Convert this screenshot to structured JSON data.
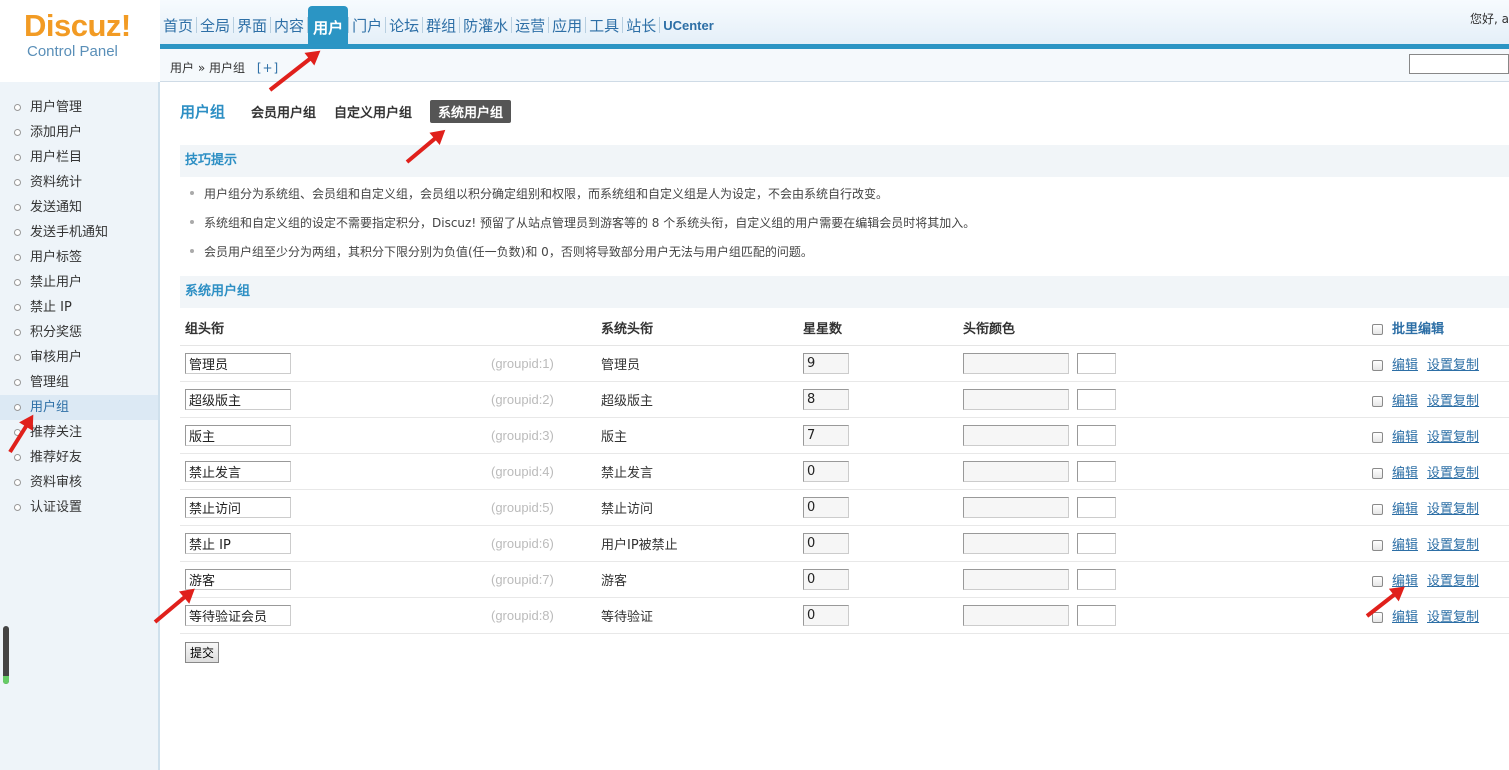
{
  "logo": {
    "main": "Discuz!",
    "sub": "Control Panel"
  },
  "nav": {
    "items": [
      "首页",
      "全局",
      "界面",
      "内容",
      "用户",
      "门户",
      "论坛",
      "群组",
      "防灌水",
      "运营",
      "应用",
      "工具",
      "站长",
      "UCenter"
    ],
    "active": "用户"
  },
  "greeting": "您好, a",
  "breadcrumb": {
    "path": "用户 » 用户组",
    "plus": "[+]"
  },
  "sidebar": {
    "items": [
      "用户管理",
      "添加用户",
      "用户栏目",
      "资料统计",
      "发送通知",
      "发送手机通知",
      "用户标签",
      "禁止用户",
      "禁止 IP",
      "积分奖惩",
      "审核用户",
      "管理组",
      "用户组",
      "推荐关注",
      "推荐好友",
      "资料审核",
      "认证设置"
    ],
    "active": "用户组"
  },
  "subnav": {
    "title": "用户组",
    "tabs": [
      "会员用户组",
      "自定义用户组",
      "系统用户组"
    ],
    "active": "系统用户组"
  },
  "tips": {
    "title": "技巧提示",
    "items": [
      "用户组分为系统组、会员组和自定义组，会员组以积分确定组别和权限，而系统组和自定义组是人为设定，不会由系统自行改变。",
      "系统组和自定义组的设定不需要指定积分，Discuz! 预留了从站点管理员到游客等的 8 个系统头衔，自定义组的用户需要在编辑会员时将其加入。",
      "会员用户组至少分为两组，其积分下限分别为负值(任一负数)和 0，否则将导致部分用户无法与用户组匹配的问题。"
    ]
  },
  "groups": {
    "title": "系统用户组",
    "headers": {
      "name": "组头衔",
      "system": "系统头衔",
      "stars": "星星数",
      "color": "头衔颜色",
      "batch": "批里编辑"
    },
    "rows": [
      {
        "name": "管理员",
        "gid": "(groupid:1)",
        "system": "管理员",
        "stars": "9"
      },
      {
        "name": "超级版主",
        "gid": "(groupid:2)",
        "system": "超级版主",
        "stars": "8"
      },
      {
        "name": "版主",
        "gid": "(groupid:3)",
        "system": "版主",
        "stars": "7"
      },
      {
        "name": "禁止发言",
        "gid": "(groupid:4)",
        "system": "禁止发言",
        "stars": "0"
      },
      {
        "name": "禁止访问",
        "gid": "(groupid:5)",
        "system": "禁止访问",
        "stars": "0"
      },
      {
        "name": "禁止 IP",
        "gid": "(groupid:6)",
        "system": "用户IP被禁止",
        "stars": "0"
      },
      {
        "name": "游客",
        "gid": "(groupid:7)",
        "system": "游客",
        "stars": "0"
      },
      {
        "name": "等待验证会员",
        "gid": "(groupid:8)",
        "system": "等待验证",
        "stars": "0"
      }
    ],
    "edit_label": "编辑",
    "copy_label": "设置复制"
  },
  "submit_label": "提交",
  "colors": {
    "accent": "#2b95c4",
    "logo": "#f29b24",
    "arrow": "#e0201b"
  }
}
